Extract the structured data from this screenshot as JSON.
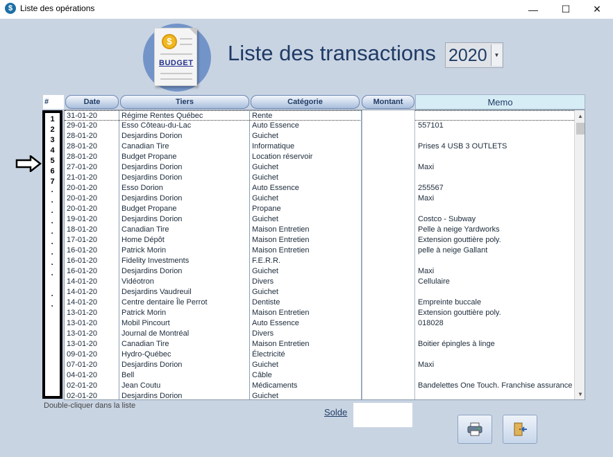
{
  "window": {
    "title": "Liste des opérations",
    "icon_symbol": "$",
    "minimize_symbol": "—",
    "maximize_symbol": "☐",
    "close_symbol": "✕"
  },
  "logo": {
    "text": "BUDGET",
    "coin_symbol": "$",
    "icon": "budget-document-icon"
  },
  "header": {
    "title": "Liste des transactions",
    "year": "2020",
    "year_arrow": "⌄"
  },
  "columns": {
    "hash": "#",
    "date": "Date",
    "tiers": "Tiers",
    "categorie": "Catégorie",
    "montant": "Montant",
    "memo": "Memo"
  },
  "row_numbers": [
    "1",
    "2",
    "3",
    "4",
    "5",
    "6",
    "7",
    "·",
    "·",
    "·",
    "·",
    "·",
    "·",
    "·",
    "·",
    "·",
    "",
    "·",
    "·"
  ],
  "pointer_icon": "right-arrow-icon",
  "rows": [
    {
      "date": "31-01-20",
      "tiers": "Régime Rentes Québec",
      "categorie": "Rente",
      "memo": ""
    },
    {
      "date": "29-01-20",
      "tiers": "Esso Côteau-du-Lac",
      "categorie": "Auto Essence",
      "memo": "557101"
    },
    {
      "date": "28-01-20",
      "tiers": "Desjardins Dorion",
      "categorie": "Guichet",
      "memo": ""
    },
    {
      "date": "28-01-20",
      "tiers": "Canadian Tire",
      "categorie": "Informatique",
      "memo": "Prises 4 USB 3 OUTLETS"
    },
    {
      "date": "28-01-20",
      "tiers": "Budget Propane",
      "categorie": "Location réservoir",
      "memo": ""
    },
    {
      "date": "27-01-20",
      "tiers": "Desjardins Dorion",
      "categorie": "Guichet",
      "memo": "Maxi"
    },
    {
      "date": "21-01-20",
      "tiers": "Desjardins Dorion",
      "categorie": "Guichet",
      "memo": ""
    },
    {
      "date": "20-01-20",
      "tiers": "Esso Dorion",
      "categorie": "Auto Essence",
      "memo": "255567"
    },
    {
      "date": "20-01-20",
      "tiers": "Desjardins Dorion",
      "categorie": "Guichet",
      "memo": "Maxi"
    },
    {
      "date": "20-01-20",
      "tiers": "Budget Propane",
      "categorie": "Propane",
      "memo": ""
    },
    {
      "date": "19-01-20",
      "tiers": "Desjardins Dorion",
      "categorie": "Guichet",
      "memo": "Costco - Subway"
    },
    {
      "date": "18-01-20",
      "tiers": "Canadian Tire",
      "categorie": "Maison Entretien",
      "memo": "Pelle à neige Yardworks"
    },
    {
      "date": "17-01-20",
      "tiers": "Home Dépôt",
      "categorie": "Maison Entretien",
      "memo": "Extension gouttière poly."
    },
    {
      "date": "16-01-20",
      "tiers": "Patrick Morin",
      "categorie": "Maison Entretien",
      "memo": "pelle à neige Gallant"
    },
    {
      "date": "16-01-20",
      "tiers": "Fidelity Investments",
      "categorie": "F.E.R.R.",
      "memo": ""
    },
    {
      "date": "16-01-20",
      "tiers": "Desjardins Dorion",
      "categorie": "Guichet",
      "memo": "Maxi"
    },
    {
      "date": "14-01-20",
      "tiers": "Vidéotron",
      "categorie": "Divers",
      "memo": "Cellulaire"
    },
    {
      "date": "14-01-20",
      "tiers": "Desjardins Vaudreuil",
      "categorie": "Guichet",
      "memo": ""
    },
    {
      "date": "14-01-20",
      "tiers": "Centre dentaire Île Perrot",
      "categorie": "Dentiste",
      "memo": "Empreinte buccale"
    },
    {
      "date": "13-01-20",
      "tiers": "Patrick Morin",
      "categorie": "Maison Entretien",
      "memo": "Extension gouttière poly."
    },
    {
      "date": "13-01-20",
      "tiers": "Mobil Pincourt",
      "categorie": "Auto Essence",
      "memo": "018028"
    },
    {
      "date": "13-01-20",
      "tiers": "Journal de Montréal",
      "categorie": "Divers",
      "memo": ""
    },
    {
      "date": "13-01-20",
      "tiers": "Canadian Tire",
      "categorie": "Maison Entretien",
      "memo": "Boitier épingles à linge"
    },
    {
      "date": "09-01-20",
      "tiers": "Hydro-Québec",
      "categorie": "Électricité",
      "memo": ""
    },
    {
      "date": "07-01-20",
      "tiers": "Desjardins Dorion",
      "categorie": "Guichet",
      "memo": "Maxi"
    },
    {
      "date": "04-01-20",
      "tiers": "Bell",
      "categorie": "Câble",
      "memo": ""
    },
    {
      "date": "02-01-20",
      "tiers": "Jean Coutu",
      "categorie": "Médicaments",
      "memo": "Bandelettes One Touch. Franchise assurance"
    },
    {
      "date": "02-01-20",
      "tiers": "Desjardins Dorion",
      "categorie": "Guichet",
      "memo": ""
    }
  ],
  "scroll": {
    "up_symbol": "▲",
    "down_symbol": "▼"
  },
  "footer": {
    "hint": "Double-cliquer dans la liste",
    "solde_label": "Solde",
    "solde_value": "",
    "print_icon": "printer-icon",
    "exit_icon": "exit-door-icon"
  },
  "colors": {
    "background": "#c9d4e3",
    "title": "#1f3b65",
    "memo_header": "#d7edf5"
  }
}
